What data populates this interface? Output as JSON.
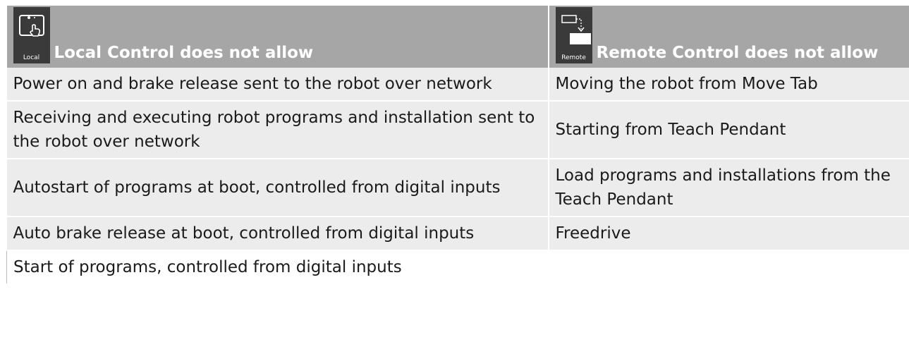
{
  "table": {
    "header": {
      "local": {
        "icon_caption": "Local",
        "label": "Local Control does not allow"
      },
      "remote": {
        "icon_caption": "Remote",
        "label": "Remote Control does not allow"
      }
    },
    "rows": [
      {
        "local": "Power on and brake release sent to the robot over network",
        "remote": "Moving the robot from Move Tab"
      },
      {
        "local": "Receiving and executing robot programs and installation sent to the robot over network",
        "remote": "Starting from Teach Pendant"
      },
      {
        "local": "Autostart of programs at boot, controlled from digital inputs",
        "remote": "Load programs and installations from the Teach Pendant"
      },
      {
        "local": "Auto brake release at boot, controlled from digital inputs",
        "remote": "Freedrive"
      },
      {
        "local": "Start of programs, controlled from digital inputs",
        "remote": ""
      }
    ]
  }
}
